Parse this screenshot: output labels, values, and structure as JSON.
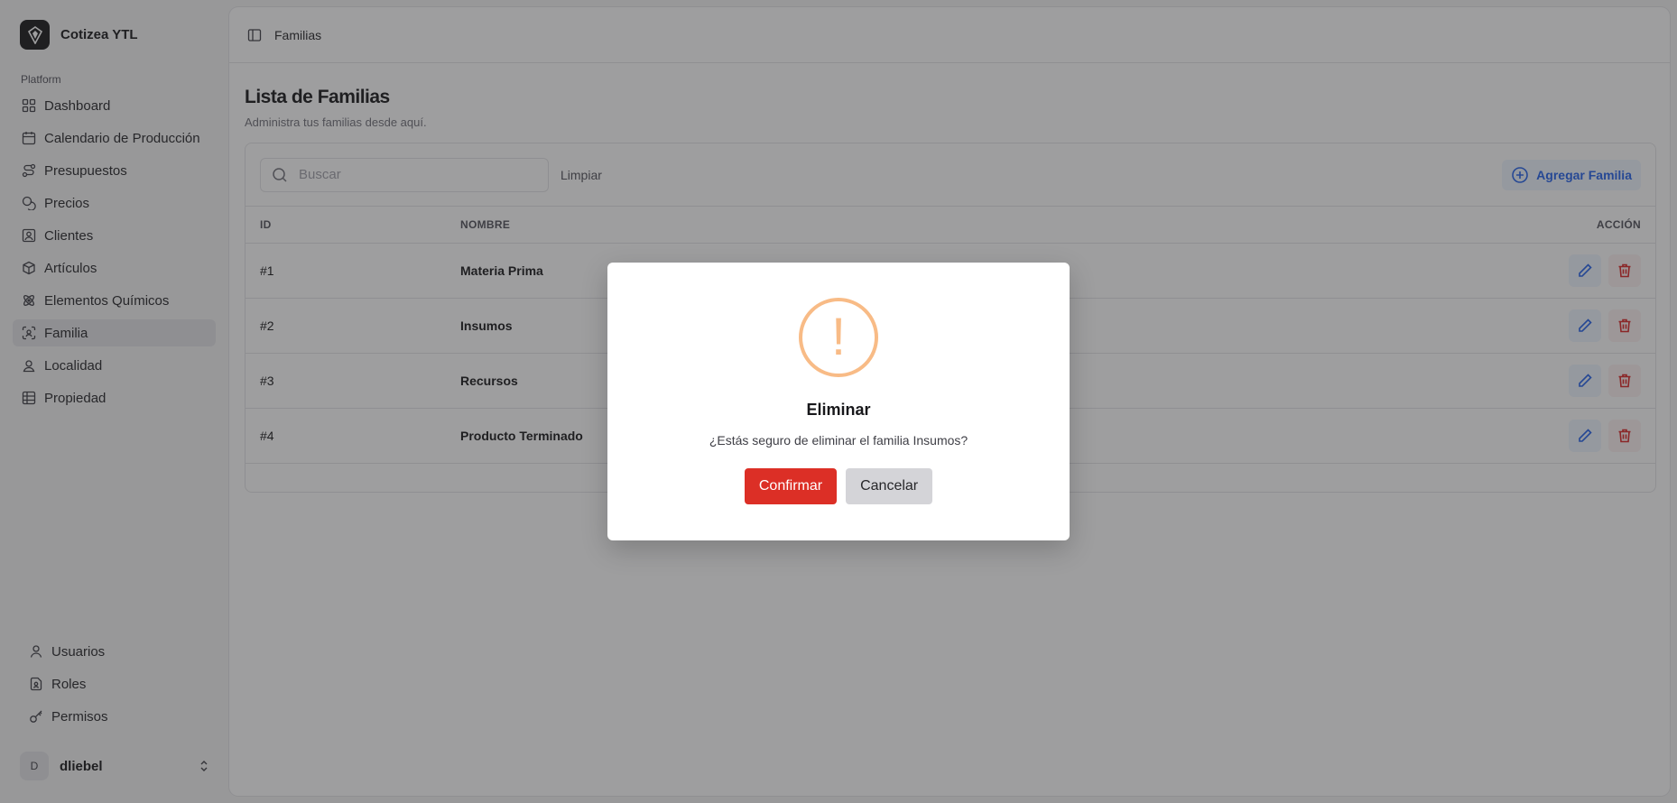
{
  "app": {
    "name": "Cotizea YTL"
  },
  "sidebar": {
    "section_label": "Platform",
    "items": [
      {
        "label": "Dashboard",
        "icon": "grid-icon",
        "active": false
      },
      {
        "label": "Calendario de Producción",
        "icon": "calendar-icon",
        "active": false
      },
      {
        "label": "Presupuestos",
        "icon": "route-icon",
        "active": false
      },
      {
        "label": "Precios",
        "icon": "coins-icon",
        "active": false
      },
      {
        "label": "Clientes",
        "icon": "contact-icon",
        "active": false
      },
      {
        "label": "Artículos",
        "icon": "box-icon",
        "active": false
      },
      {
        "label": "Elementos Químicos",
        "icon": "atom-icon",
        "active": false
      },
      {
        "label": "Familia",
        "icon": "scan-face-icon",
        "active": true
      },
      {
        "label": "Localidad",
        "icon": "map-pin-user-icon",
        "active": false
      },
      {
        "label": "Propiedad",
        "icon": "table-icon",
        "active": false
      }
    ],
    "bottom_items": [
      {
        "label": "Usuarios",
        "icon": "user-icon"
      },
      {
        "label": "Roles",
        "icon": "file-user-icon"
      },
      {
        "label": "Permisos",
        "icon": "key-icon"
      }
    ],
    "user": {
      "initial": "D",
      "name": "dliebel"
    }
  },
  "header": {
    "breadcrumb": "Familias"
  },
  "page": {
    "title": "Lista de Familias",
    "subtitle": "Administra tus familias desde aquí."
  },
  "toolbar": {
    "search_placeholder": "Buscar",
    "clear_label": "Limpiar",
    "add_label": "Agregar Familia"
  },
  "table": {
    "columns": [
      "ID",
      "NOMBRE",
      "ACCIÓN"
    ],
    "rows": [
      {
        "id": "#1",
        "name": "Materia Prima"
      },
      {
        "id": "#2",
        "name": "Insumos"
      },
      {
        "id": "#3",
        "name": "Recursos"
      },
      {
        "id": "#4",
        "name": "Producto Terminado"
      }
    ]
  },
  "modal": {
    "icon": "!",
    "title": "Eliminar",
    "message": "¿Estás seguro de eliminar el familia Insumos?",
    "confirm_label": "Confirmar",
    "cancel_label": "Cancelar"
  },
  "colors": {
    "accent_blue": "#2563eb",
    "danger_red": "#dc2f26",
    "warning_orange": "#f8bb86"
  }
}
